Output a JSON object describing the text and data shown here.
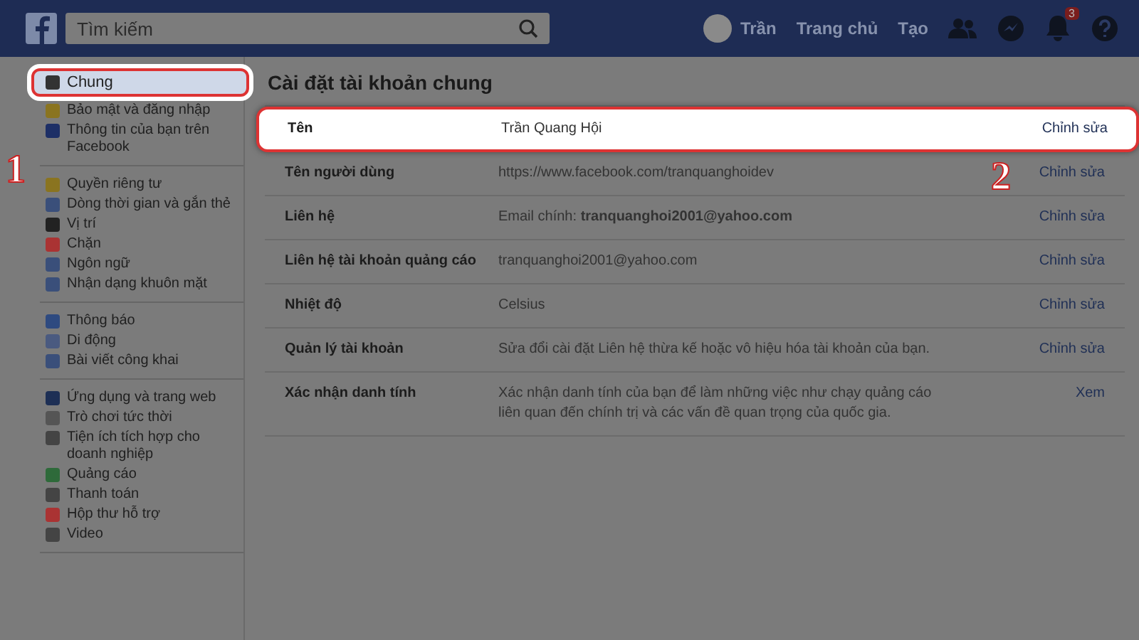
{
  "header": {
    "search": {
      "placeholder": "Tìm kiếm"
    },
    "profile": {
      "name": "Trần"
    },
    "nav": [
      "Trang chủ",
      "Tạo"
    ],
    "notifications_badge": "3"
  },
  "sidebar": {
    "groups": [
      {
        "items": [
          {
            "label": "Chung",
            "selected": true
          },
          {
            "label": "Bảo mật và đăng nhập",
            "selected": false
          },
          {
            "label": "Thông tin của bạn trên Facebook",
            "selected": false
          }
        ]
      },
      {
        "items": [
          {
            "label": "Quyền riêng tư",
            "selected": false
          },
          {
            "label": "Dòng thời gian và gắn thẻ",
            "selected": false
          },
          {
            "label": "Vị trí",
            "selected": false
          },
          {
            "label": "Chặn",
            "selected": false
          },
          {
            "label": "Ngôn ngữ",
            "selected": false
          },
          {
            "label": "Nhận dạng khuôn mặt",
            "selected": false
          }
        ]
      },
      {
        "items": [
          {
            "label": "Thông báo",
            "selected": false
          },
          {
            "label": "Di động",
            "selected": false
          },
          {
            "label": "Bài viết công khai",
            "selected": false
          }
        ]
      },
      {
        "items": [
          {
            "label": "Ứng dụng và trang web",
            "selected": false
          },
          {
            "label": "Trò chơi tức thời",
            "selected": false
          },
          {
            "label": "Tiện ích tích hợp cho doanh nghiệp",
            "selected": false
          },
          {
            "label": "Quảng cáo",
            "selected": false
          },
          {
            "label": "Thanh toán",
            "selected": false
          },
          {
            "label": "Hộp thư hỗ trợ",
            "selected": false
          },
          {
            "label": "Video",
            "selected": false
          }
        ]
      }
    ]
  },
  "main": {
    "title": "Cài đặt tài khoản chung",
    "rows": [
      {
        "label": "Tên",
        "value": "Trần Quang Hội",
        "action": "Chỉnh sửa",
        "highlighted": true
      },
      {
        "label": "Tên người dùng",
        "value": "https://www.facebook.com/tranquanghoidev",
        "action": "Chỉnh sửa",
        "highlighted": false
      },
      {
        "label": "Liên hệ",
        "value": "Email chính: **tranquanghoi2001@yahoo.com**",
        "action": "Chỉnh sửa",
        "highlighted": false
      },
      {
        "label": "Liên hệ tài khoản quảng cáo",
        "value": "tranquanghoi2001@yahoo.com",
        "action": "Chỉnh sửa",
        "highlighted": false
      },
      {
        "label": "Nhiệt độ",
        "value": "Celsius",
        "action": "Chỉnh sửa",
        "highlighted": false
      },
      {
        "label": "Quản lý tài khoản",
        "value": "Sửa đổi cài đặt Liên hệ thừa kế hoặc vô hiệu hóa tài khoản của bạn.",
        "action": "Chỉnh sửa",
        "highlighted": false
      },
      {
        "label": "Xác nhận danh tính",
        "value": "Xác nhận danh tính của bạn để làm những việc như chạy quảng cáo liên quan đến chính trị và các vấn đề quan trọng của quốc gia.",
        "action": "Xem",
        "highlighted": false
      }
    ]
  },
  "annotations": [
    "1",
    "2"
  ]
}
